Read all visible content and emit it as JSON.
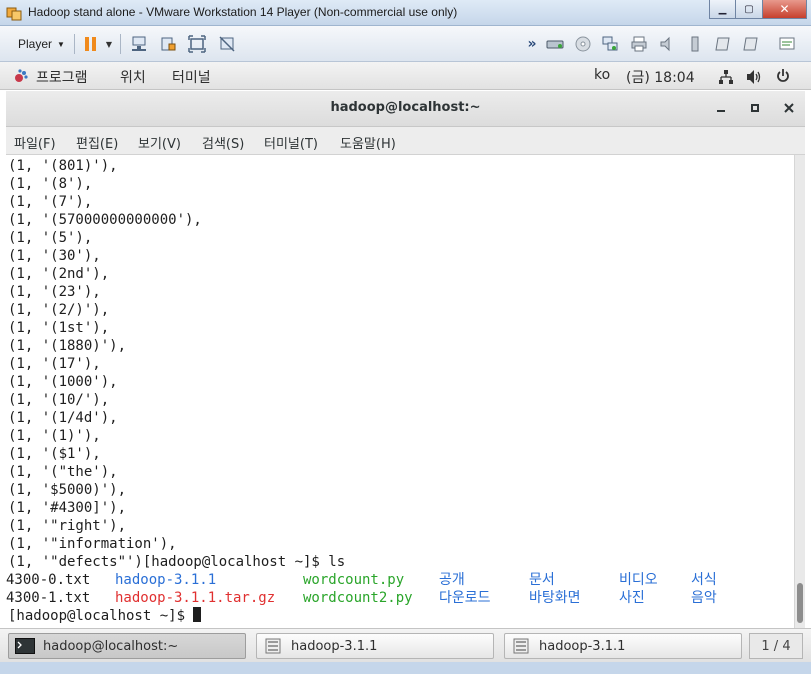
{
  "window": {
    "title": "Hadoop stand alone - VMware Workstation 14 Player (Non-commercial use only)",
    "minimize": "▁",
    "maximize": "▢",
    "close": "✕"
  },
  "vm_toolbar": {
    "player_label": "Player",
    "dropdown_glyph": "▼",
    "arrows_glyph": "»"
  },
  "gnome_topbar": {
    "applications": "프로그램",
    "places": "위치",
    "terminal": "터미널",
    "keyboard": "ko",
    "clock": "(금) 18:04"
  },
  "terminal": {
    "title": "hadoop@localhost:~",
    "menu": [
      "파일(F)",
      "편집(E)",
      "보기(V)",
      "검색(S)",
      "터미널(T)",
      "도움말(H)"
    ],
    "lines": [
      "(1, '(801)'),",
      "(1, '(8'),",
      "(1, '(7'),",
      "(1, '(57000000000000'),",
      "(1, '(5'),",
      "(1, '(30'),",
      "(1, '(2nd'),",
      "(1, '(23'),",
      "(1, '(2/)'),",
      "(1, '(1st'),",
      "(1, '(1880)'),",
      "(1, '(17'),",
      "(1, '(1000'),",
      "(1, '(10/'),",
      "(1, '(1/4d'),",
      "(1, '(1)'),",
      "(1, '($1'),",
      "(1, '(\"the'),",
      "(1, '$5000)'),",
      "(1, '#4300]'),",
      "(1, '\"right'),",
      "(1, '\"information'),",
      "(1, '\"defects\"')[hadoop@localhost ~]$ ls"
    ],
    "ls_rows": [
      [
        {
          "text": "4300-0.txt",
          "kind": "plain"
        },
        {
          "text": "hadoop-3.1.1",
          "kind": "dir"
        },
        {
          "text": "wordcount.py",
          "kind": "exec"
        },
        {
          "text": "공개",
          "kind": "dir"
        },
        {
          "text": "문서",
          "kind": "dir"
        },
        {
          "text": "비디오",
          "kind": "dir"
        },
        {
          "text": "서식",
          "kind": "dir"
        }
      ],
      [
        {
          "text": "4300-1.txt",
          "kind": "plain"
        },
        {
          "text": "hadoop-3.1.1.tar.gz",
          "kind": "arch"
        },
        {
          "text": "wordcount2.py",
          "kind": "exec"
        },
        {
          "text": "다운로드",
          "kind": "dir"
        },
        {
          "text": "바탕화면",
          "kind": "dir"
        },
        {
          "text": "사진",
          "kind": "dir"
        },
        {
          "text": "음악",
          "kind": "dir"
        }
      ]
    ],
    "prompt": "[hadoop@localhost ~]$ "
  },
  "taskbar": {
    "items": [
      {
        "label": "hadoop@localhost:~",
        "active": true
      },
      {
        "label": "hadoop-3.1.1",
        "active": false
      },
      {
        "label": "hadoop-3.1.1",
        "active": false
      }
    ],
    "pager": "1 / 4"
  },
  "colors": {
    "plain": "#1e1e1e",
    "dir": "#2a6fd6",
    "arch": "#e03030",
    "exec": "#2aa52a"
  }
}
